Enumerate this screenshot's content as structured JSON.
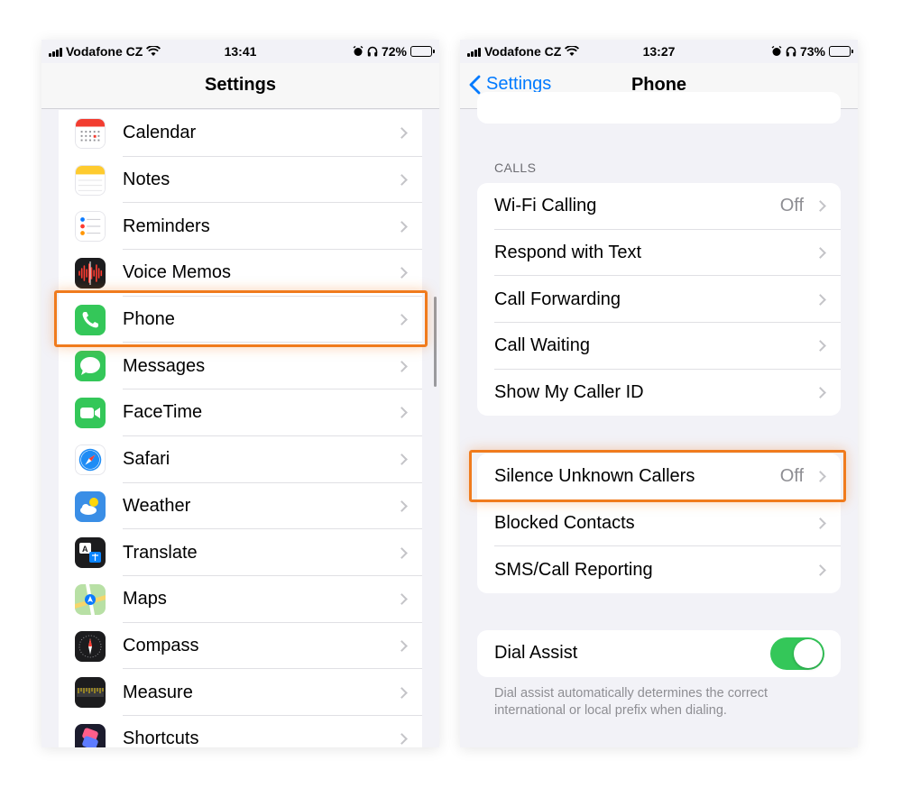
{
  "left_screen": {
    "status": {
      "carrier": "Vodafone CZ",
      "time": "13:41",
      "battery": "72%",
      "battery_level": 0.72
    },
    "nav_title": "Settings",
    "items": [
      {
        "label": "Calendar",
        "icon": "calendar-icon"
      },
      {
        "label": "Notes",
        "icon": "notes-icon"
      },
      {
        "label": "Reminders",
        "icon": "reminders-icon"
      },
      {
        "label": "Voice Memos",
        "icon": "voice-memos-icon"
      },
      {
        "label": "Phone",
        "icon": "phone-icon"
      },
      {
        "label": "Messages",
        "icon": "messages-icon"
      },
      {
        "label": "FaceTime",
        "icon": "facetime-icon"
      },
      {
        "label": "Safari",
        "icon": "safari-icon"
      },
      {
        "label": "Weather",
        "icon": "weather-icon"
      },
      {
        "label": "Translate",
        "icon": "translate-icon"
      },
      {
        "label": "Maps",
        "icon": "maps-icon"
      },
      {
        "label": "Compass",
        "icon": "compass-icon"
      },
      {
        "label": "Measure",
        "icon": "measure-icon"
      },
      {
        "label": "Shortcuts",
        "icon": "shortcuts-icon"
      }
    ]
  },
  "right_screen": {
    "status": {
      "carrier": "Vodafone CZ",
      "time": "13:27",
      "battery": "73%",
      "battery_level": 0.73
    },
    "back_label": "Settings",
    "nav_title": "Phone",
    "section_header": "CALLS",
    "calls_group": [
      {
        "label": "Wi-Fi Calling",
        "value": "Off"
      },
      {
        "label": "Respond with Text",
        "value": ""
      },
      {
        "label": "Call Forwarding",
        "value": ""
      },
      {
        "label": "Call Waiting",
        "value": ""
      },
      {
        "label": "Show My Caller ID",
        "value": ""
      }
    ],
    "privacy_group": [
      {
        "label": "Silence Unknown Callers",
        "value": "Off"
      },
      {
        "label": "Blocked Contacts",
        "value": ""
      },
      {
        "label": "SMS/Call Reporting",
        "value": ""
      }
    ],
    "dial_assist": {
      "label": "Dial Assist",
      "enabled": true
    },
    "dial_assist_note": "Dial assist automatically determines the correct international or local prefix when dialing."
  },
  "colors": {
    "accent_blue": "#007aff",
    "highlight_orange": "#f07b1d",
    "toggle_green": "#34c759"
  }
}
